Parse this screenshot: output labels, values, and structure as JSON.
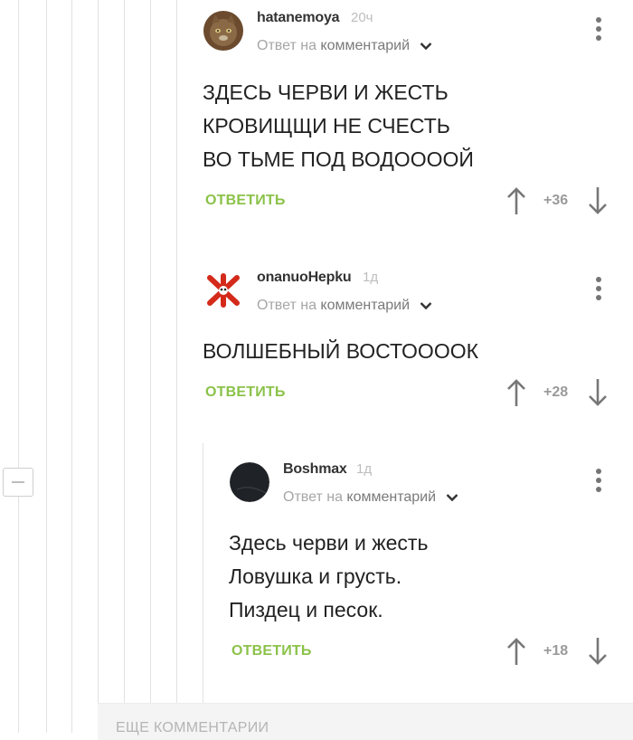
{
  "comments": [
    {
      "author": "hatanemoya",
      "time": "20ч",
      "reply_prefix": "Ответ на",
      "reply_link": "комментарий",
      "lines": [
        "ЗДЕСЬ ЧЕРВИ И ЖЕСТЬ",
        "КРОВИЩЩИ НЕ СЧЕСТЬ",
        "ВО ТЬМЕ ПОД ВОДООООЙ"
      ],
      "reply_label": "ОТВЕТИТЬ",
      "score": "+36",
      "avatar_icon": "cat-avatar-icon"
    },
    {
      "author": "onanuoHepku",
      "time": "1д",
      "reply_prefix": "Ответ на",
      "reply_link": "комментарий",
      "lines": [
        "ВОЛШЕБНЫЙ ВОСТОООOК"
      ],
      "reply_label": "ОТВЕТИТЬ",
      "score": "+28",
      "avatar_icon": "red-letter-avatar-icon"
    },
    {
      "author": "Boshmax",
      "time": "1д",
      "reply_prefix": "Ответ на",
      "reply_link": "комментарий",
      "lines": [
        "Здесь черви и жесть",
        "Ловушка и грусть.",
        "Пиздец и песок."
      ],
      "reply_label": "ОТВЕТИТЬ",
      "score": "+18",
      "avatar_icon": "dark-circle-avatar-icon"
    }
  ],
  "more_comments": "ЕЩЕ КОММЕНТАРИИ",
  "colors": {
    "accent": "#8bc24a",
    "muted": "#a6a6a6",
    "line": "#e2e2e2"
  }
}
